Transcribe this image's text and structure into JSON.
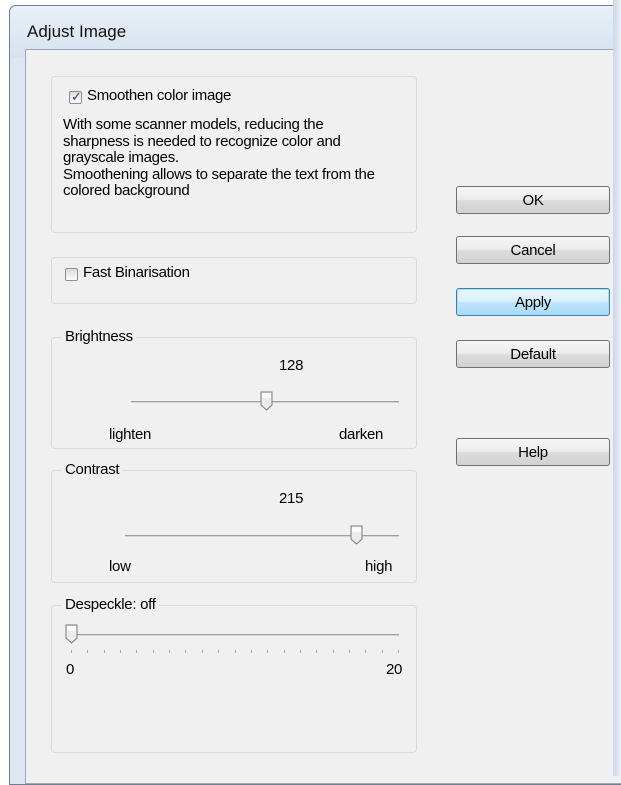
{
  "window": {
    "title": "Adjust Image"
  },
  "smoothen": {
    "label": "Smoothen color image",
    "checked": true,
    "description": [
      "With some scanner models, reducing the",
      "sharpness is needed to recognize color and",
      "grayscale images.",
      "Smoothening allows to separate the text from the",
      "colored background"
    ]
  },
  "fast_binarisation": {
    "label": "Fast Binarisation",
    "checked": false
  },
  "brightness": {
    "title": "Brightness",
    "value": "128",
    "min_label": "lighten",
    "max_label": "darken",
    "level": 128,
    "range": [
      0,
      255
    ]
  },
  "contrast": {
    "title": "Contrast",
    "value": "215",
    "min_label": "low",
    "max_label": "high",
    "level": 215,
    "range": [
      0,
      255
    ]
  },
  "despeckle": {
    "title": "Despeckle: off",
    "min": "0",
    "max": "20",
    "level": 0
  },
  "buttons": {
    "ok": "OK",
    "cancel": "Cancel",
    "apply": "Apply",
    "default": "Default",
    "help": "Help"
  }
}
